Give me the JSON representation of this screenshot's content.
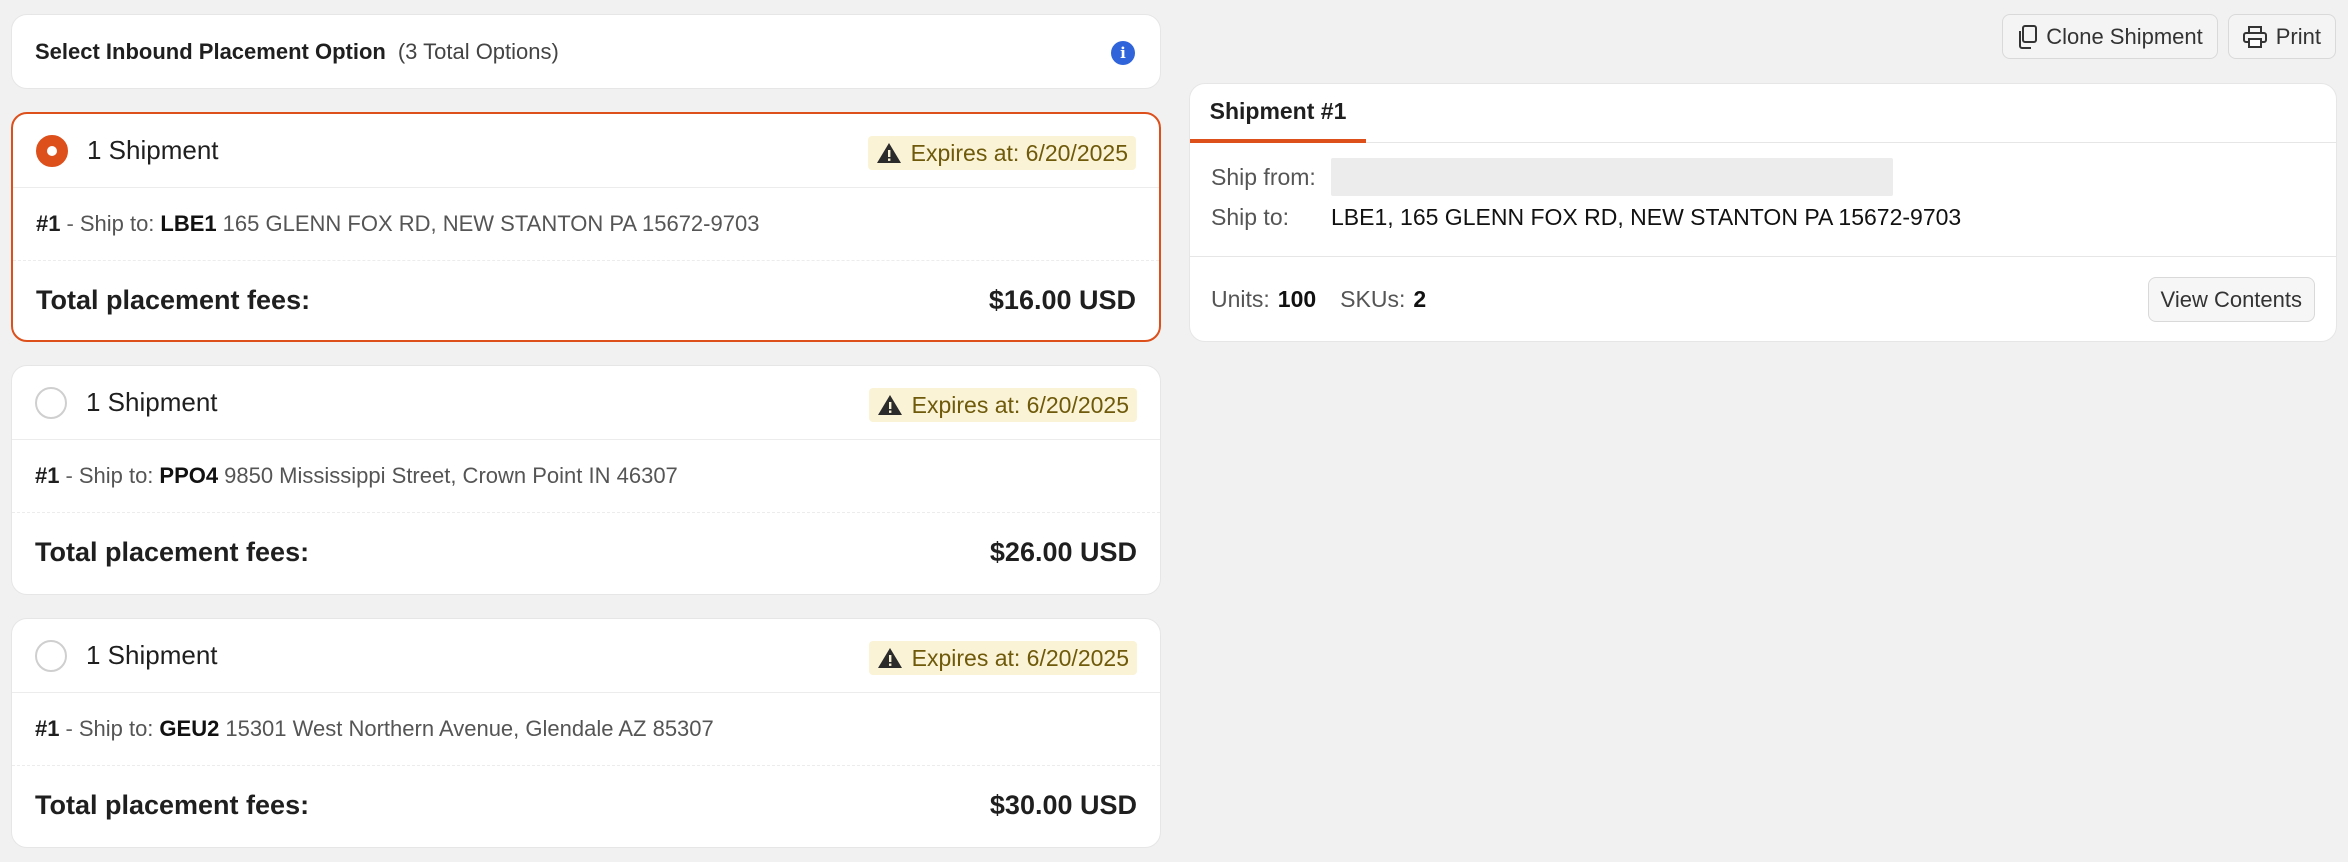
{
  "header": {
    "title": "Select Inbound Placement Option",
    "count": "(3 Total Options)",
    "info_icon": "i"
  },
  "options": [
    {
      "selected": true,
      "count": "1 Shipment",
      "expires": "Expires at: 6/20/2025",
      "num": "#1",
      "sep": "-",
      "ship_to_label": "Ship to:",
      "code": "LBE1",
      "address": "165 GLENN FOX RD, NEW STANTON PA 15672-9703",
      "fees_label": "Total placement fees:",
      "fees_value": "$16.00 USD"
    },
    {
      "selected": false,
      "count": "1 Shipment",
      "expires": "Expires at: 6/20/2025",
      "num": "#1",
      "sep": "-",
      "ship_to_label": "Ship to:",
      "code": "PPO4",
      "address": "9850 Mississippi Street, Crown Point IN 46307",
      "fees_label": "Total placement fees:",
      "fees_value": "$26.00 USD"
    },
    {
      "selected": false,
      "count": "1 Shipment",
      "expires": "Expires at: 6/20/2025",
      "num": "#1",
      "sep": "-",
      "ship_to_label": "Ship to:",
      "code": "GEU2",
      "address": "15301 West Northern Avenue, Glendale AZ 85307",
      "fees_label": "Total placement fees:",
      "fees_value": "$30.00 USD"
    }
  ],
  "toolbar": {
    "clone_label": "Clone Shipment",
    "print_label": "Print"
  },
  "shipment_panel": {
    "tab_label": "Shipment #1",
    "ship_from_label": "Ship from:",
    "ship_to_label": "Ship to:",
    "ship_to_value": "LBE1, 165 GLENN FOX RD, NEW STANTON PA 15672-9703",
    "units_label": "Units:",
    "units_value": "100",
    "skus_label": "SKUs:",
    "skus_value": "2",
    "view_contents_label": "View Contents"
  },
  "colors": {
    "accent": "#dd4f1b",
    "info": "#2f64db",
    "warning_bg": "#fbf3d6",
    "warning_text": "#6e5a0a"
  },
  "icons": {
    "info": "info-icon",
    "warning": "warning-icon",
    "clone": "copy-icon",
    "print": "printer-icon"
  }
}
